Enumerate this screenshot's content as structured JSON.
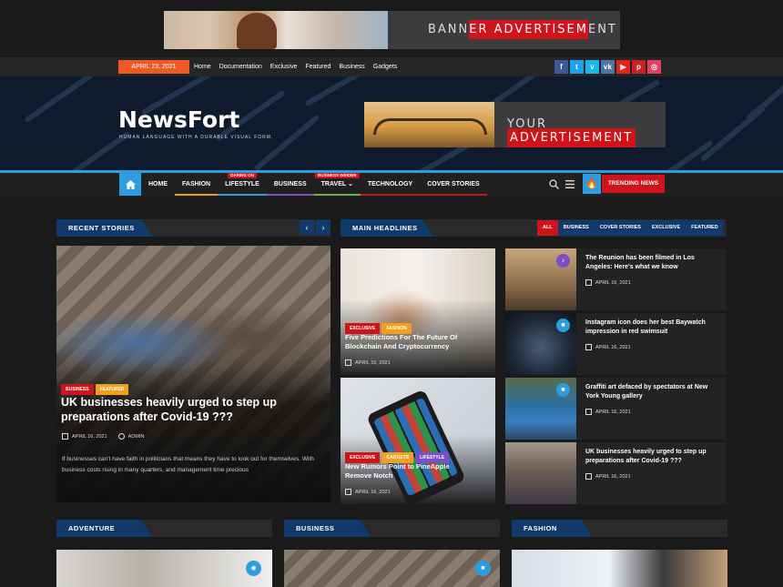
{
  "banner_top": {
    "text_pre": "BANN",
    "text_hl": "ER ADVERTISEM",
    "text_post": "ENT"
  },
  "topbar": {
    "date": "APRIL 23, 2021",
    "links": [
      "Home",
      "Documentation",
      "Exclusive",
      "Featured",
      "Business",
      "Gadgets"
    ],
    "social_icons": [
      {
        "name": "facebook-icon",
        "glyph": "f",
        "color": "#3b5998"
      },
      {
        "name": "twitter-icon",
        "glyph": "t",
        "color": "#1da1f2"
      },
      {
        "name": "vimeo-icon",
        "glyph": "v",
        "color": "#1ab7ea"
      },
      {
        "name": "vk-icon",
        "glyph": "vk",
        "color": "#4c75a3"
      },
      {
        "name": "youtube-icon",
        "glyph": "▶",
        "color": "#e62117"
      },
      {
        "name": "pinterest-icon",
        "glyph": "p",
        "color": "#cb2027"
      },
      {
        "name": "instagram-icon",
        "glyph": "◎",
        "color": "#e4405f"
      }
    ]
  },
  "header": {
    "logo": "NewsFort",
    "tagline": "HUMAN LANGUAGE WITH A DURABLE VISUAL FORM.",
    "ad_pre": "YOUR ",
    "ad_hl": "ADVERTISEMENT"
  },
  "nav": {
    "items": [
      {
        "label": "HOME",
        "underline": "",
        "tag": ""
      },
      {
        "label": "FASHION",
        "underline": "#f0a01c",
        "tag": ""
      },
      {
        "label": "LIFESTYLE",
        "underline": "#2c9ee0",
        "tag": "DARING ON"
      },
      {
        "label": "BUSINESS",
        "underline": "#7b4fc6",
        "tag": ""
      },
      {
        "label": "TRAVEL ⌄",
        "underline": "#6db33f",
        "tag": "BUSINESS INSIDER"
      },
      {
        "label": "TECHNOLOGY",
        "underline": "#d0121b",
        "tag": ""
      },
      {
        "label": "COVER STORIES",
        "underline": "#d0121b",
        "tag": ""
      }
    ],
    "trending": "TRENDING NEWS",
    "accent": "#2c9ee0"
  },
  "recent": {
    "header": "RECENT STORIES",
    "badges": [
      "BUSINESS",
      "FEATURED"
    ],
    "title": "UK businesses heavily urged to step up preparations after Covid-19 ???",
    "date": "APRIL 16, 2021",
    "author": "ADMIN",
    "excerpt": "If businesses can't have faith in politicians that means they have to look out for themselves. With business costs rising in many quarters, and management time precious"
  },
  "headlines": {
    "header": "MAIN HEADLINES",
    "filters": [
      "ALL",
      "BUSINESS",
      "COVER STORIES",
      "EXCLUSIVE",
      "FEATURED"
    ],
    "cards": [
      {
        "badges": [
          "EXCLUSIVE",
          "FASHION"
        ],
        "title": "Five Predictions For The Future Of Blockchain And Cryptocurrency",
        "date": "APRIL 16, 2021"
      },
      {
        "badges": [
          "EXCLUSIVE",
          "GADGETS",
          "LIFESTYLE"
        ],
        "title": "New Rumors Point to PineApple Remove Notch",
        "date": "APRIL 16, 2021"
      }
    ],
    "side": [
      {
        "title": "The Reunion has been filmed in Los Angeles: Here's what we know",
        "date": "APRIL 16, 2021",
        "icon": "music-icon",
        "glyph": "♪",
        "icon_color": "#7b4fc6"
      },
      {
        "title": "Instagram icon does her best Baywatch impression in red swimsuit",
        "date": "APRIL 16, 2021",
        "icon": "video-icon",
        "glyph": "■",
        "icon_color": "#2c9ee0"
      },
      {
        "title": "Graffiti art defaced by spectators at New York Young gallery",
        "date": "APRIL 16, 2021",
        "icon": "video-icon",
        "glyph": "■",
        "icon_color": "#2c9ee0"
      },
      {
        "title": "UK businesses heavily urged to step up preparations after Covid-19 ???",
        "date": "APRIL 16, 2021",
        "icon": "",
        "glyph": "",
        "icon_color": ""
      }
    ]
  },
  "bottom_sections": [
    "ADVENTURE",
    "BUSINESS",
    "FASHION"
  ]
}
